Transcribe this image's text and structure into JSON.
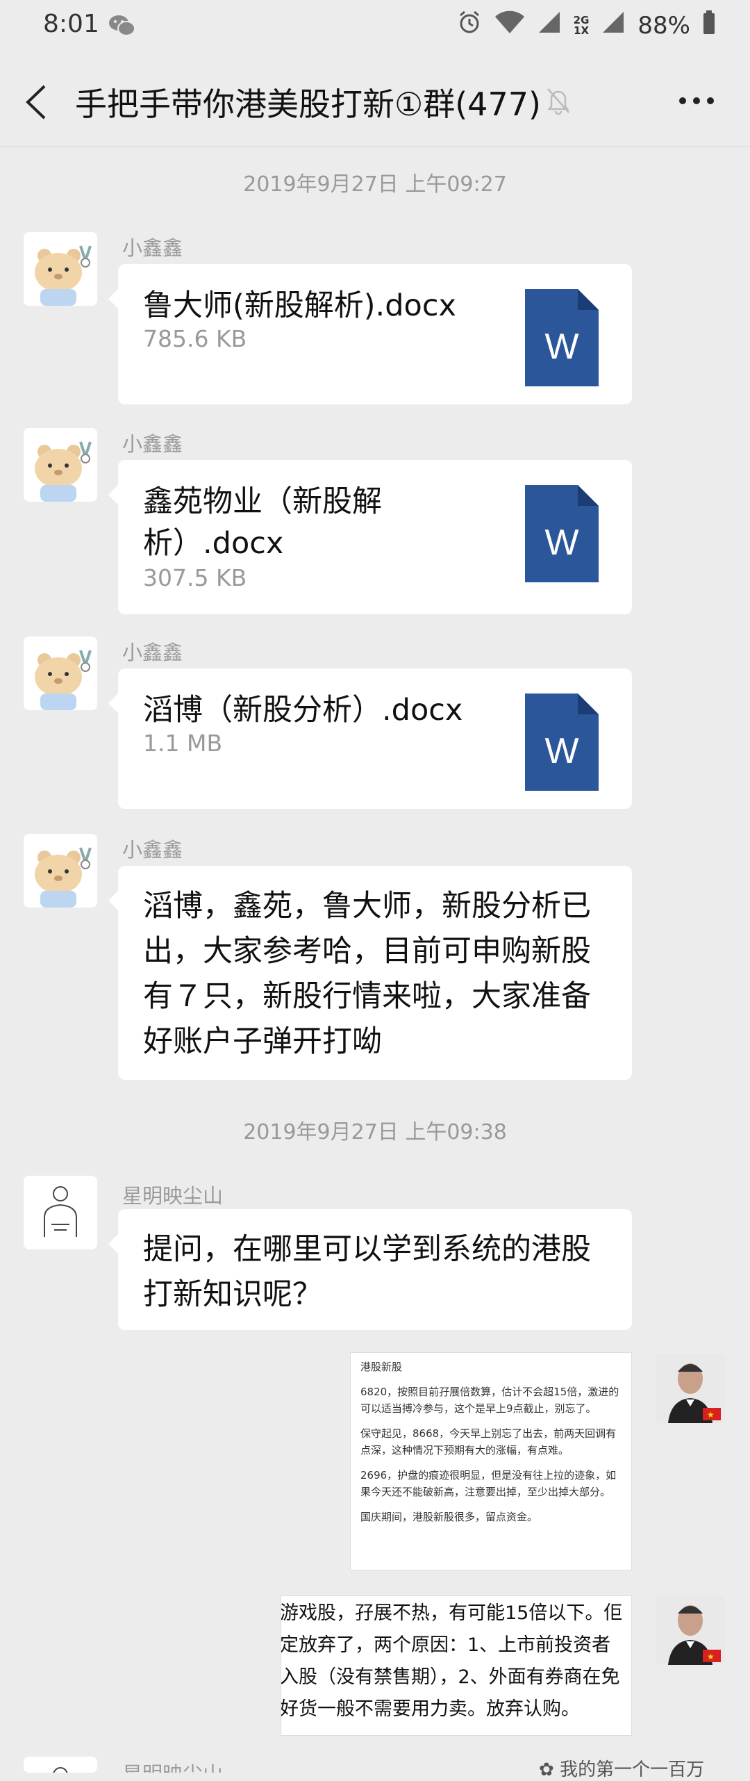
{
  "status_bar": {
    "time": "8:01",
    "net_top": "2G",
    "net_bottom": "1X",
    "battery": "88%"
  },
  "header": {
    "title": "手把手带你港美股打新①群(477)"
  },
  "timestamps": [
    "2019年9月27日 上午09:27",
    "2019年9月27日 上午09:38"
  ],
  "messages": [
    {
      "sender": "小鑫鑫",
      "file_name": "鲁大师(新股解析).docx",
      "file_size": "785.6 KB",
      "icon": "word-file-icon"
    },
    {
      "sender": "小鑫鑫",
      "file_name": "鑫苑物业（新股解析）.docx",
      "file_size": "307.5 KB",
      "icon": "word-file-icon"
    },
    {
      "sender": "小鑫鑫",
      "file_name": "滔博（新股分析）.docx",
      "file_size": "1.1 MB",
      "icon": "word-file-icon"
    },
    {
      "sender": "小鑫鑫",
      "text": "滔博，鑫苑，鲁大师，新股分析已出，大家参考哈，目前可申购新股有７只，新股行情来啦，大家准备好账户子弹开打呦"
    },
    {
      "sender": "星明映尘山",
      "text": "提问，在哪里可以学到系统的港股打新知识呢？"
    },
    {
      "sender": "星明映尘山"
    }
  ],
  "word_letter": "W",
  "image_note_1": {
    "title": "港股新股",
    "p1": "6820，按照目前孖展倍数算，估计不会超15倍，激进的可以适当搏冷参与，这个是早上9点截止，别忘了。",
    "p2": "保守起见，8668，今天早上别忘了出去，前两天回调有点深，这种情况下预期有大的涨幅，有点难。",
    "p3": "2696，护盘的痕迹很明显，但是没有往上拉的迹象，如果今天还不能破新高，注意要出掉，至少出掉大部分。",
    "p4": "国庆期间，港股新股很多，留点资金。"
  },
  "image_note_2": {
    "lines": [
      "游戏股，孖展不热，有可能15倍以下。佢",
      "定放弃了，两个原因：1、上市前投资者",
      "入股（没有禁售期），2、外面有券商在免",
      "好货一般不需要用力卖。放弃认购。"
    ]
  },
  "watermark": "我的第一个一百万",
  "colors": {
    "background": "#ececec",
    "bubble": "#ffffff",
    "word_blue": "#2b579a",
    "meta_gray": "#999999"
  }
}
